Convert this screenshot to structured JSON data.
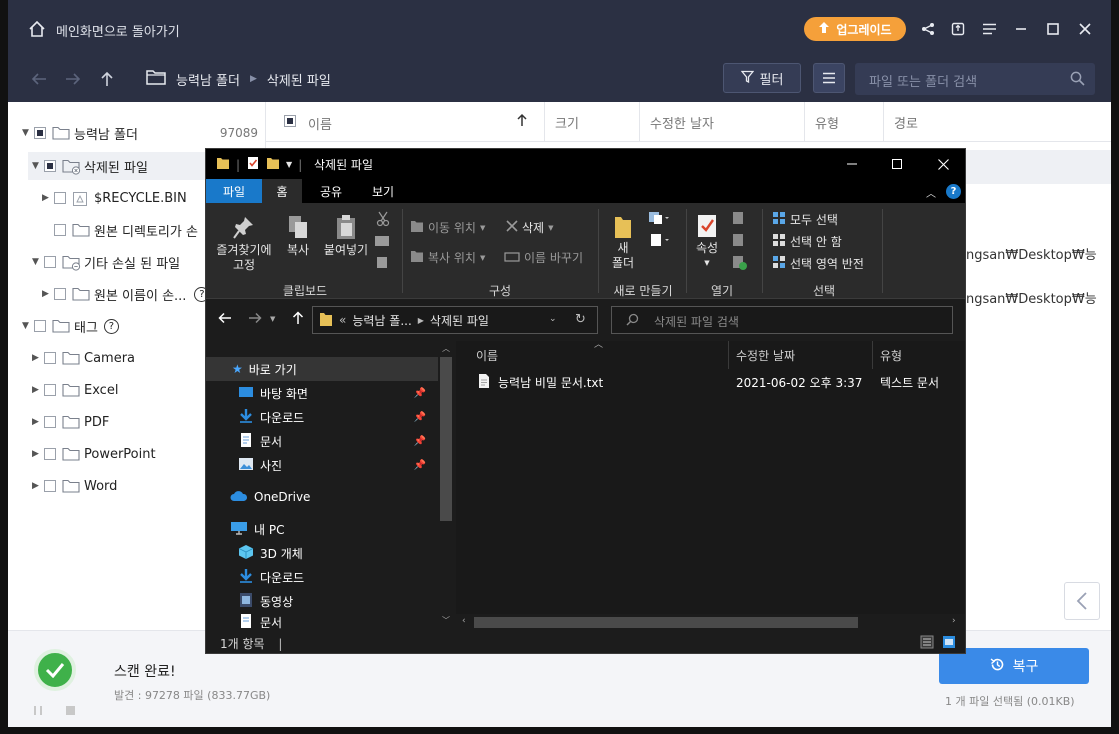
{
  "titlebar": {
    "back_to_main": "메인화면으로 돌아가기",
    "upgrade_label": "업그레이드"
  },
  "navbar": {
    "breadcrumb": [
      "능력남 폴더",
      "삭제된 파일"
    ],
    "filter_label": "필터",
    "search_placeholder": "파일 또는 폴더 검색"
  },
  "sidebar": {
    "items": [
      {
        "label": "능력남 폴더",
        "count": "97089"
      },
      {
        "label": "삭제된 파일"
      },
      {
        "label": "$RECYCLE.BIN"
      },
      {
        "label": "원본 디렉토리가 손"
      },
      {
        "label": "기타 손실 된 파일"
      },
      {
        "label": "원본 이름이 손..."
      },
      {
        "label": "태그"
      },
      {
        "label": "Camera"
      },
      {
        "label": "Excel"
      },
      {
        "label": "PDF"
      },
      {
        "label": "PowerPoint"
      },
      {
        "label": "Word"
      }
    ]
  },
  "list": {
    "columns": [
      "이름",
      "크기",
      "수정한 날자",
      "유형",
      "경로"
    ],
    "rows": [
      {
        "path": "ongsan₩Desktop₩능"
      },
      {
        "path": "ongsan₩Desktop₩능"
      }
    ]
  },
  "bottombar": {
    "scan_status": "스캔 완료!",
    "found": "발견 : 97278 파일 (833.77GB)",
    "recover_label": "복구",
    "selected_info": "1 개 파일 선택됨 (0.01KB)"
  },
  "explorer": {
    "title": "삭제된 파일",
    "tabs": [
      "파일",
      "홈",
      "공유",
      "보기"
    ],
    "ribbon": {
      "pin": "즐겨찾기에\n고정",
      "copy": "복사",
      "paste": "붙여넣기",
      "move_to": "이동 위치",
      "copy_to": "복사 위치",
      "delete": "삭제",
      "rename": "이름 바꾸기",
      "new_folder": "새\n폴더",
      "properties": "속성",
      "select_all": "모두 선택",
      "select_none": "선택 안 함",
      "invert_selection": "선택 영역 반전",
      "groups": [
        "클립보드",
        "구성",
        "새로 만들기",
        "열기",
        "선택"
      ]
    },
    "address": {
      "parent": "능력남 폴...",
      "current": "삭제된 파일"
    },
    "search_placeholder": "삭제된 파일 검색",
    "nav": {
      "quick_access": "바로 가기",
      "desktop": "바탕 화면",
      "downloads": "다운로드",
      "documents": "문서",
      "pictures": "사진",
      "onedrive": "OneDrive",
      "this_pc": "내 PC",
      "objects3d": "3D 개체",
      "downloads2": "다운로드",
      "videos": "동영상",
      "documents2": "문서"
    },
    "columns": {
      "name": "이름",
      "date": "수정한 날짜",
      "type": "유형"
    },
    "file": {
      "name": "능력남 비밀 문서.txt",
      "date": "2021-06-02 오후 3:37",
      "type": "텍스트 문서"
    },
    "status": "1개 항목"
  }
}
